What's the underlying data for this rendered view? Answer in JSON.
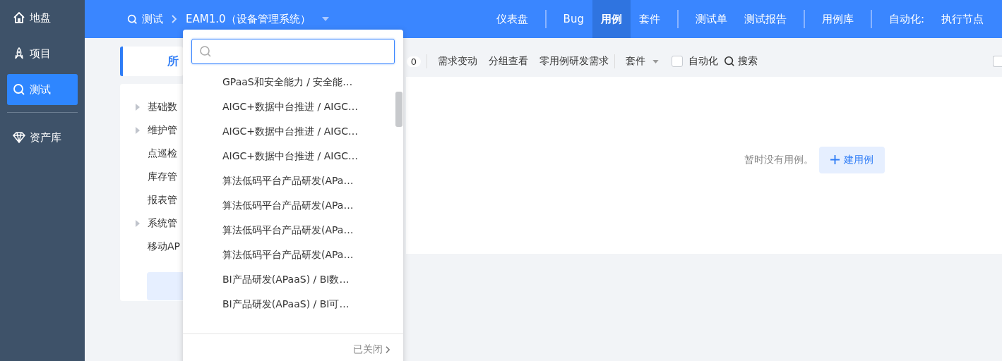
{
  "sidebar": {
    "items": [
      {
        "label": "地盘",
        "kind": "home",
        "selected": false
      },
      {
        "label": "项目",
        "kind": "rocket",
        "selected": false
      },
      {
        "label": "测试",
        "kind": "search",
        "selected": true
      },
      {
        "label": "资产库",
        "kind": "gem",
        "selected": false
      }
    ]
  },
  "breadcrumb": {
    "module": "测试",
    "product": "EAM1.0（设备管理系统）"
  },
  "nav_groups": [
    [
      {
        "label": "仪表盘",
        "selected": false
      }
    ],
    [
      {
        "label": "Bug",
        "selected": false
      },
      {
        "label": "用例",
        "selected": true
      },
      {
        "label": "套件",
        "selected": false
      }
    ],
    [
      {
        "label": "测试单",
        "selected": false
      },
      {
        "label": "测试报告",
        "selected": false
      }
    ],
    [
      {
        "label": "用例库",
        "selected": false
      }
    ],
    [
      {
        "label": "自动化:",
        "selected": false
      },
      {
        "label": "执行节点",
        "selected": false
      }
    ]
  ],
  "tab": {
    "label": "所"
  },
  "toolbar": {
    "count": "0",
    "items": [
      "需求变动",
      "分组查看",
      "零用例研发需求"
    ],
    "suite_menu": "套件",
    "automation": {
      "label": "自动化",
      "checked": false
    },
    "search": "搜索",
    "edge_checkbox": {
      "checked": false
    }
  },
  "tree": [
    {
      "label": "基础数",
      "kind": "folder"
    },
    {
      "label": "维护管",
      "kind": "folder"
    },
    {
      "label": "点巡检",
      "kind": "leaf"
    },
    {
      "label": "库存管",
      "kind": "leaf"
    },
    {
      "label": "报表管",
      "kind": "leaf"
    },
    {
      "label": "系统管",
      "kind": "folder"
    },
    {
      "label": "移动AP",
      "kind": "leaf"
    }
  ],
  "empty": {
    "message": "暂时没有用例。",
    "button": "建用例"
  },
  "dropdown": {
    "items": [
      "GPaaS和安全能力 / 安全能…",
      "AIGC+数据中台推进 / AIGC…",
      "AIGC+数据中台推进 / AIGC…",
      "AIGC+数据中台推进 / AIGC…",
      "算法低码平台产品研发(APa…",
      "算法低码平台产品研发(APa…",
      "算法低码平台产品研发(APa…",
      "算法低码平台产品研发(APa…",
      "BI产品研发(APaaS) / BI数…",
      "BI产品研发(APaaS) / BI可…"
    ],
    "footer": "已关闭"
  }
}
